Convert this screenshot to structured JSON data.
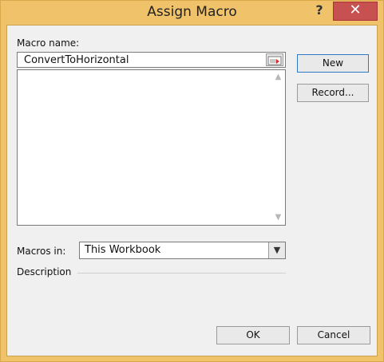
{
  "window": {
    "title": "Assign Macro",
    "help_label": "?",
    "close_label": "✕"
  },
  "form": {
    "macro_name_label": "Macro name:",
    "macro_name_value": "ConvertToHorizontal",
    "macros_in_label": "Macros in:",
    "macros_in_value": "This Workbook",
    "description_label": "Description"
  },
  "buttons": {
    "new": "New",
    "record": "Record...",
    "ok": "OK",
    "cancel": "Cancel"
  },
  "icons": {
    "scroll_up": "▲",
    "scroll_down": "▼",
    "dropdown": "▼"
  }
}
